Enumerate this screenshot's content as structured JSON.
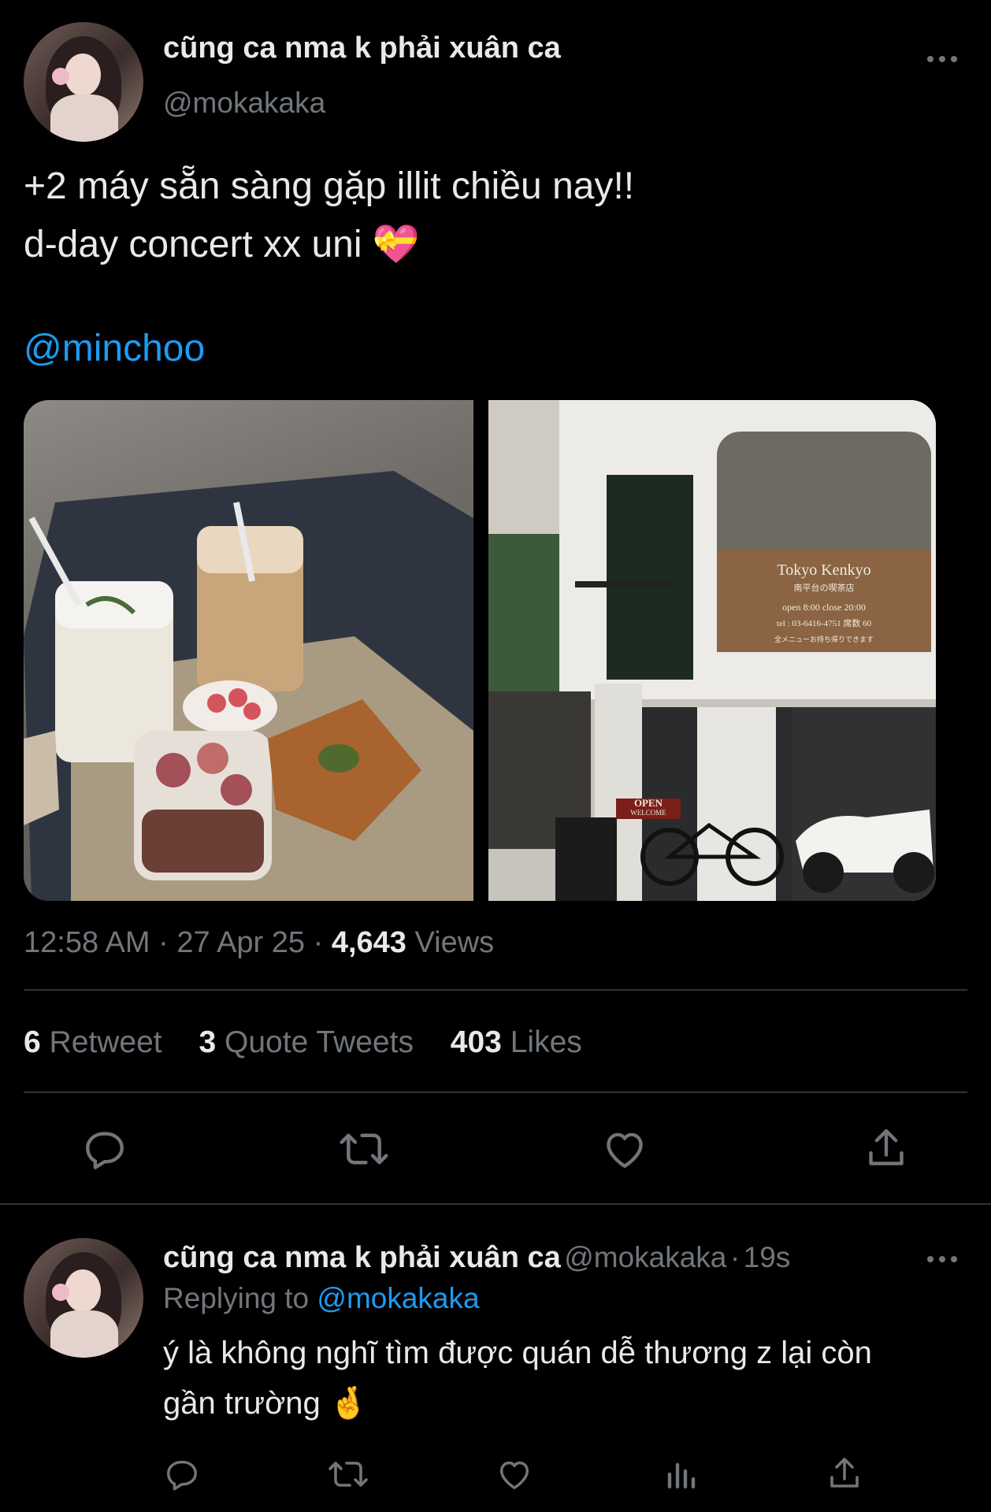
{
  "main_tweet": {
    "author_name": "cũng ca nma k phải xuân ca",
    "author_handle": "@mokakaka",
    "more_icon": "more-horizontal-icon",
    "text_line1": "+2 máy sẵn sàng gặp illit chiều nay!!",
    "text_line2": "d-day concert xx uni",
    "text_emoji": "💝",
    "mention": "@minchoo",
    "media": {
      "photo1_desc_icon": "photo",
      "photo2_sign_title": "Tokyo Kenkyo",
      "photo2_sign_sub": "南平台の喫茶店",
      "photo2_sign_hours": "open 8:00  close 20:00",
      "photo2_sign_tel": "tel : 03-6416-4751      席数 60",
      "photo2_sign_note": "全メニューお持ち帰りできます",
      "photo2_open_sign": "OPEN",
      "photo2_welcome": "WELCOME"
    },
    "time": "12:58 AM",
    "date": "27 Apr 25",
    "views_count": "4,643",
    "views_label": "Views",
    "separator": "·",
    "retweet_count": "6",
    "retweet_label": "Retweet",
    "quote_count": "3",
    "quote_label": "Quote Tweets",
    "like_count": "403",
    "like_label": "Likes",
    "actions": [
      "reply-icon",
      "retweet-icon",
      "like-icon",
      "share-icon"
    ]
  },
  "reply_tweet": {
    "author_name": "cũng ca nma k phải xuân ca",
    "author_handle": "@mokakaka",
    "time_ago": "19s",
    "replying_to_label": "Replying to",
    "replying_to_handle": "@mokakaka",
    "text_line1": "ý là không nghĩ tìm được quán dễ thương z lại còn",
    "text_line2": "gần trường",
    "text_emoji": "🤞",
    "actions": [
      "reply-icon",
      "retweet-icon",
      "like-icon",
      "analytics-icon",
      "share-icon"
    ]
  },
  "colors": {
    "background": "#000000",
    "text": "#e7e9ea",
    "secondary": "#71767b",
    "link": "#1d9bf0",
    "divider": "#2f3336"
  }
}
